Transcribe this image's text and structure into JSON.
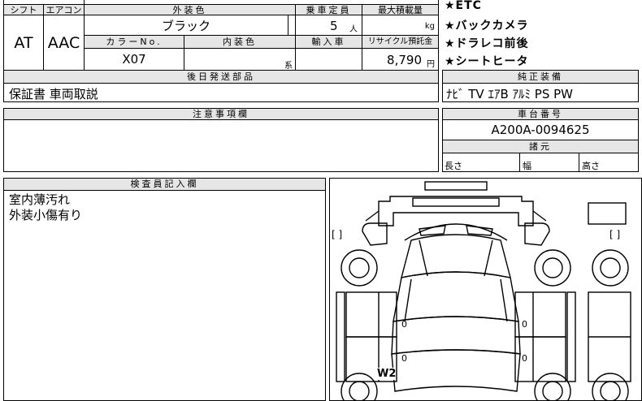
{
  "spec_table": {
    "shift": {
      "header": "シフト",
      "value": "AT"
    },
    "aircon": {
      "header": "エアコン",
      "value": "AAC"
    },
    "exterior_color": {
      "header": "外装色",
      "value": "ブラック"
    },
    "capacity": {
      "header": "乗車定員",
      "value": "5",
      "unit": "人"
    },
    "max_load": {
      "header": "最大積載量",
      "unit": "kg"
    },
    "color_no": {
      "header": "カラーNo.",
      "value": "X07"
    },
    "interior_color": {
      "header": "内装色",
      "value": "",
      "unit": "系"
    },
    "import": {
      "header": "輸入車",
      "value": ""
    },
    "recycle_fee": {
      "header": "リサイクル預託金",
      "value": "8,790",
      "unit": "円"
    }
  },
  "later_parts": {
    "header": "後日発送部品",
    "value": "保証書 車両取説"
  },
  "notes": {
    "header": "注意事項欄",
    "value": ""
  },
  "inspector": {
    "header": "検査員記入欄",
    "lines": [
      "室内薄汚れ",
      "外装小傷有り"
    ]
  },
  "options": [
    "★ETC",
    "★バックカメラ",
    "★ドラレコ前後",
    "★シートヒータ"
  ],
  "factory_equipment": {
    "header": "純正装備",
    "value": "ﾅﾋﾞ TV ｴｱB ｱﾙﾐ PS PW"
  },
  "chassis": {
    "header": "車台番号",
    "value": "A200A-0094625"
  },
  "dimensions": {
    "header": "諸元",
    "length": "長さ",
    "width": "幅",
    "height": "高さ"
  },
  "diagram": {
    "bracket": "[ ]",
    "zero": "0",
    "damage_mark": "W2"
  }
}
